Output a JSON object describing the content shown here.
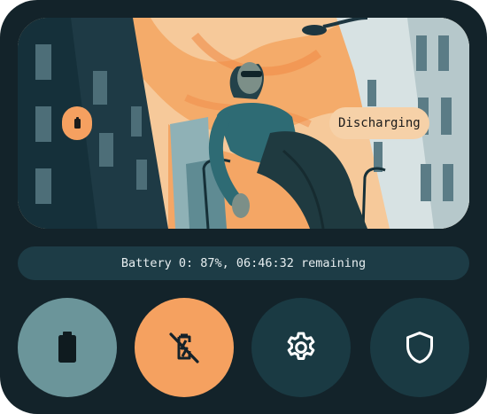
{
  "hero": {
    "status_chip": "Discharging",
    "badge_icon": "battery-icon"
  },
  "status": {
    "text": "Battery 0: 87%, 06:46:32 remaining"
  },
  "buttons": [
    {
      "icon": "battery-icon"
    },
    {
      "icon": "power-off-icon"
    },
    {
      "icon": "gear-icon"
    },
    {
      "icon": "shield-icon"
    }
  ],
  "colors": {
    "background": "#13232a",
    "accent_orange": "#f5a160",
    "teal_button": "#6b959a",
    "dark_button": "#1a3a43",
    "status_bar": "#1d3c46",
    "chip": "#f6d1a8"
  }
}
